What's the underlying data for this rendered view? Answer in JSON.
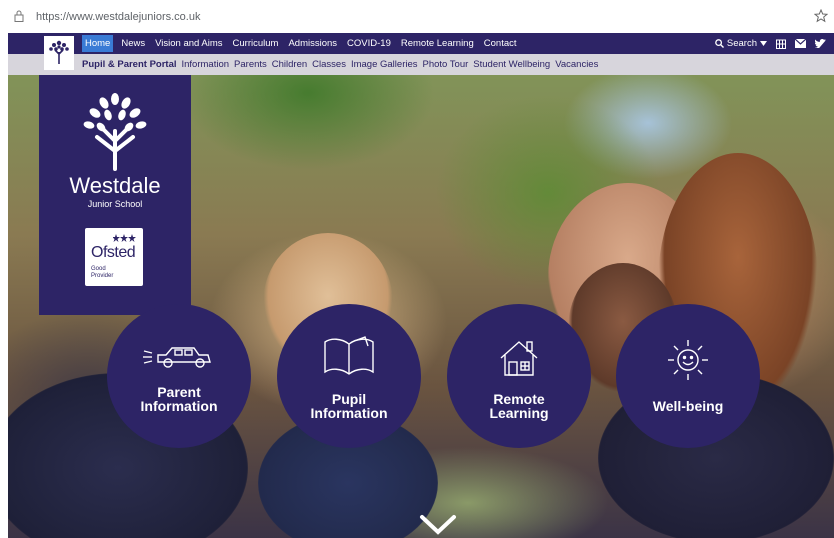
{
  "browser": {
    "url": "https://www.westdalejuniors.co.uk",
    "lock_icon": "lock-icon",
    "star_icon": "bookmark-star-icon"
  },
  "nav_primary": {
    "items": [
      "Home",
      "News",
      "Vision and Aims",
      "Curriculum",
      "Admissions",
      "COVID-19",
      "Remote Learning",
      "Contact"
    ],
    "active": "Home",
    "search_label": "Search",
    "icons": [
      "search-icon",
      "caret-down-icon",
      "calendar-icon",
      "envelope-icon",
      "twitter-icon"
    ]
  },
  "nav_secondary": {
    "items": [
      "Pupil & Parent Portal",
      "Information",
      "Parents",
      "Children",
      "Classes",
      "Image Galleries",
      "Photo Tour",
      "Student Wellbeing",
      "Vacancies"
    ]
  },
  "school": {
    "name": "Westdale",
    "subtitle": "Junior School",
    "ofsted_word": "Ofsted",
    "ofsted_rating_line1": "Good",
    "ofsted_rating_line2": "Provider"
  },
  "quick_links": [
    {
      "line1": "Parent",
      "line2": "Information",
      "icon": "car-icon"
    },
    {
      "line1": "Pupil",
      "line2": "Information",
      "icon": "open-book-icon"
    },
    {
      "line1": "Remote",
      "line2": "Learning",
      "icon": "house-icon"
    },
    {
      "line1": "Well-being",
      "line2": "",
      "icon": "smiling-sun-icon"
    }
  ],
  "colors": {
    "brand": "#2d2466",
    "active_nav": "#3a7bd5",
    "secondary_nav_bg": "#d7d5dc"
  },
  "scroll_icon": "chevron-down-icon"
}
